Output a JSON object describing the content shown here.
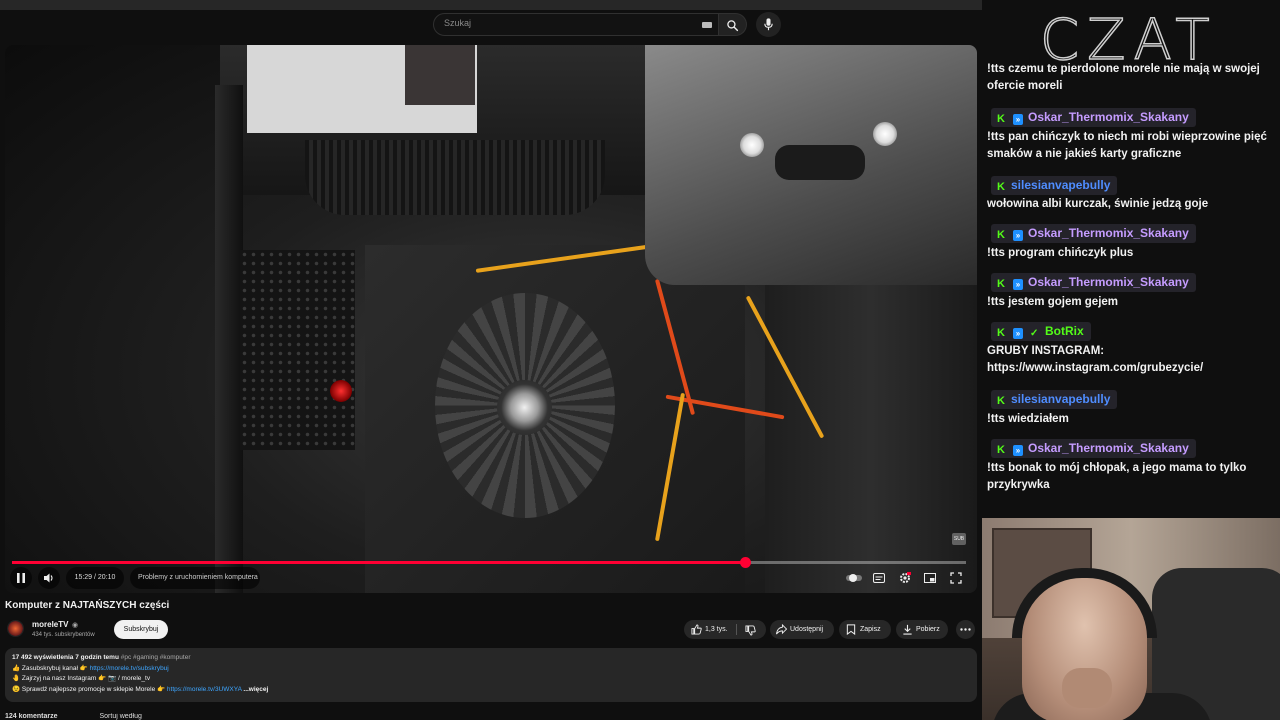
{
  "search": {
    "placeholder": "Szukaj"
  },
  "player": {
    "time": "15:29 / 20:10",
    "chapter": "Problemy z uruchomieniem komputera",
    "progress": 0.768,
    "watermark": "SUB"
  },
  "video": {
    "title": "Komputer z NAJTAŃSZYCH części",
    "channel": "moreleTV",
    "subscribers": "434 tys. subskrybentów",
    "subscribe_label": "Subskrybuj",
    "likes": "1,3 tys.",
    "share_label": "Udostępnij",
    "save_label": "Zapisz",
    "download_label": "Pobierz"
  },
  "description": {
    "stats": "17 492 wyświetlenia  7 godzin temu",
    "tags": "#pc #gaming #komputer",
    "line1_text": "👍 Zasubskrybuj kanał 👉",
    "line1_link": "https://morele.tv/subskrybuj",
    "line2_text": "🤚 Zajrzyj na nasz Instagram 👉 📷",
    "line2_link": "/ morele_tv",
    "line3_text": "😉 Sprawdź najlepsze promocje w sklepie Morele 👉",
    "line3_link": "https://morele.tv/3UWXYA",
    "more_label": "...więcej"
  },
  "below": {
    "comments": "124 komentarze",
    "sort": "Sortuj według"
  },
  "chat": {
    "logo": "CZAT",
    "messages": [
      {
        "user": "",
        "text": "!tts czemu te pierdolone morele nie mają w swojej ofercie moreli"
      },
      {
        "user": "Oskar_Thermomix_Skakany",
        "text": "!tts pan chińczyk to niech mi robi wieprzowine pięć smaków a nie jakieś karty graficzne"
      },
      {
        "user": "silesianvapebully",
        "text": "wołowina albi kurczak, świnie jedzą goje"
      },
      {
        "user": "Oskar_Thermomix_Skakany",
        "text": "!tts program chińczyk plus"
      },
      {
        "user": "Oskar_Thermomix_Skakany",
        "text": "!tts jestem gojem gejem"
      },
      {
        "user": "BotRix",
        "text": "GRUBY INSTAGRAM: https://www.instagram.com/grubezycie/"
      },
      {
        "user": "silesianvapebully",
        "text": "!tts wiedziałem"
      },
      {
        "user": "Oskar_Thermomix_Skakany",
        "text": "!tts bonak to mój chłopak, a jego mama to tylko przykrywka"
      }
    ]
  },
  "colors": {
    "accent_red": "#ff0033",
    "user_oskar": "#c59cff",
    "user_silesian": "#4f8dff",
    "user_botrix": "#53fc18",
    "kick_green": "#53fc18",
    "link": "#3ea6ff"
  },
  "icons": {
    "keyboard": "keyboard-icon",
    "search": "search-icon",
    "mic": "mic-icon",
    "pause": "pause-icon",
    "volume": "volume-icon",
    "like": "thumbs-up-icon",
    "dislike": "thumbs-down-icon",
    "share": "share-icon",
    "save": "bookmark-icon",
    "download": "download-icon",
    "more": "more-vert-icon",
    "autoplay": "autoplay-toggle-icon",
    "subtitles": "subtitles-icon",
    "settings": "gear-icon",
    "miniplayer": "miniplayer-icon",
    "fullscreen": "fullscreen-icon",
    "kick": "kick-badge-icon",
    "sub_badge": "subscriber-badge-icon",
    "verified": "verified-icon"
  }
}
